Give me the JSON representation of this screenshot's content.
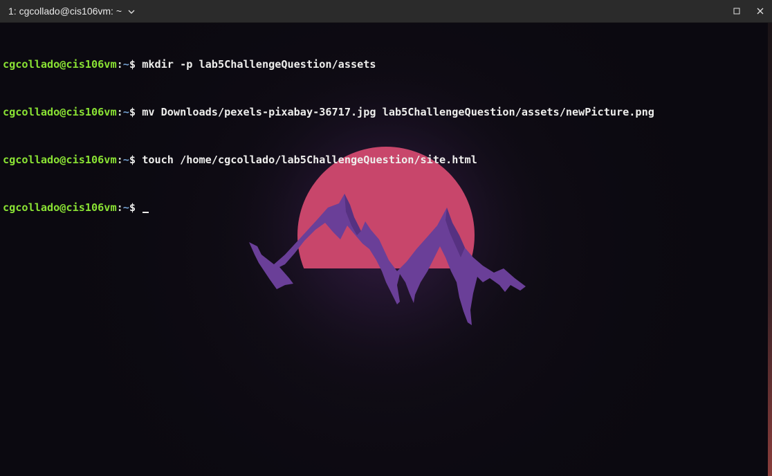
{
  "window": {
    "title": "1: cgcollado@cis106vm: ~"
  },
  "terminal": {
    "prompt": {
      "user": "cgcollado@cis106vm",
      "separator": ":",
      "path": "~",
      "symbol": "$"
    },
    "lines": [
      {
        "command": "mkdir -p lab5ChallengeQuestion/assets"
      },
      {
        "command": "mv Downloads/pexels-pixabay-36717.jpg lab5ChallengeQuestion/assets/newPicture.png"
      },
      {
        "command": "touch /home/cgcollado/lab5ChallengeQuestion/site.html"
      },
      {
        "command": ""
      }
    ]
  },
  "colors": {
    "titlebar": "#2b2b2b",
    "background": "#0b0910",
    "prompt_user": "#8ae234",
    "prompt_path": "#729fcf",
    "sun": "#c8466b",
    "mountains": "#6a3f98"
  },
  "icons": {
    "tab_menu": "chevron-down-icon",
    "maximize": "maximize-icon",
    "close": "close-icon"
  }
}
